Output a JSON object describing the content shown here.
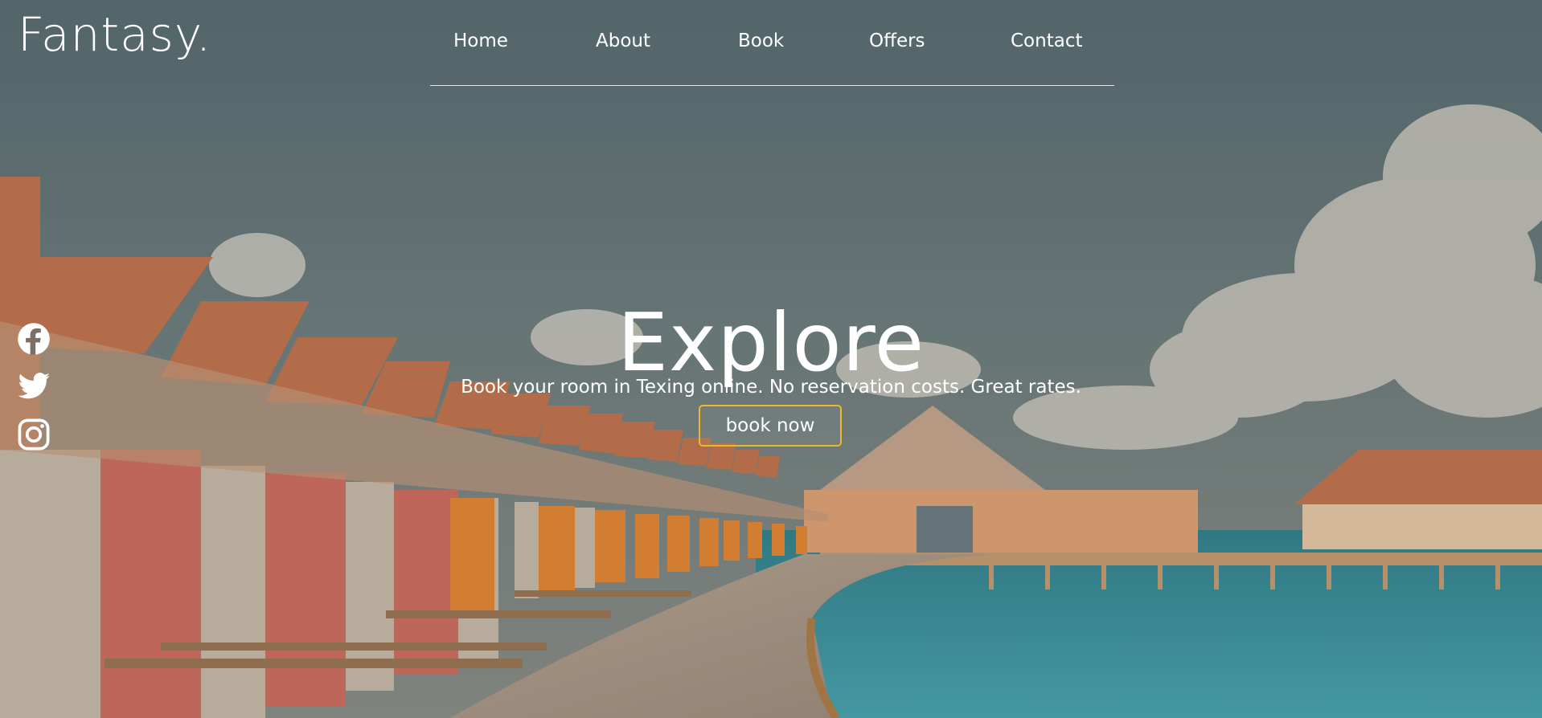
{
  "brand": {
    "logo_text": "Fantasy."
  },
  "nav": {
    "items": [
      "Home",
      "About",
      "Book",
      "Offers",
      "Contact"
    ]
  },
  "hero": {
    "title": "Explore",
    "subtitle": "Book your room in Texing online. No reservation costs. Great rates.",
    "cta_label": "book now"
  },
  "social": {
    "icons": [
      "facebook-icon",
      "twitter-icon",
      "instagram-icon"
    ]
  },
  "colors": {
    "text": "#ffffff",
    "cta_border": "#e8b92d",
    "sky": "#5d7075",
    "sea": "#3f97a3",
    "roof": "#c7754e",
    "wall_pink": "#d16a5c",
    "wall_orange": "#e6862f"
  }
}
